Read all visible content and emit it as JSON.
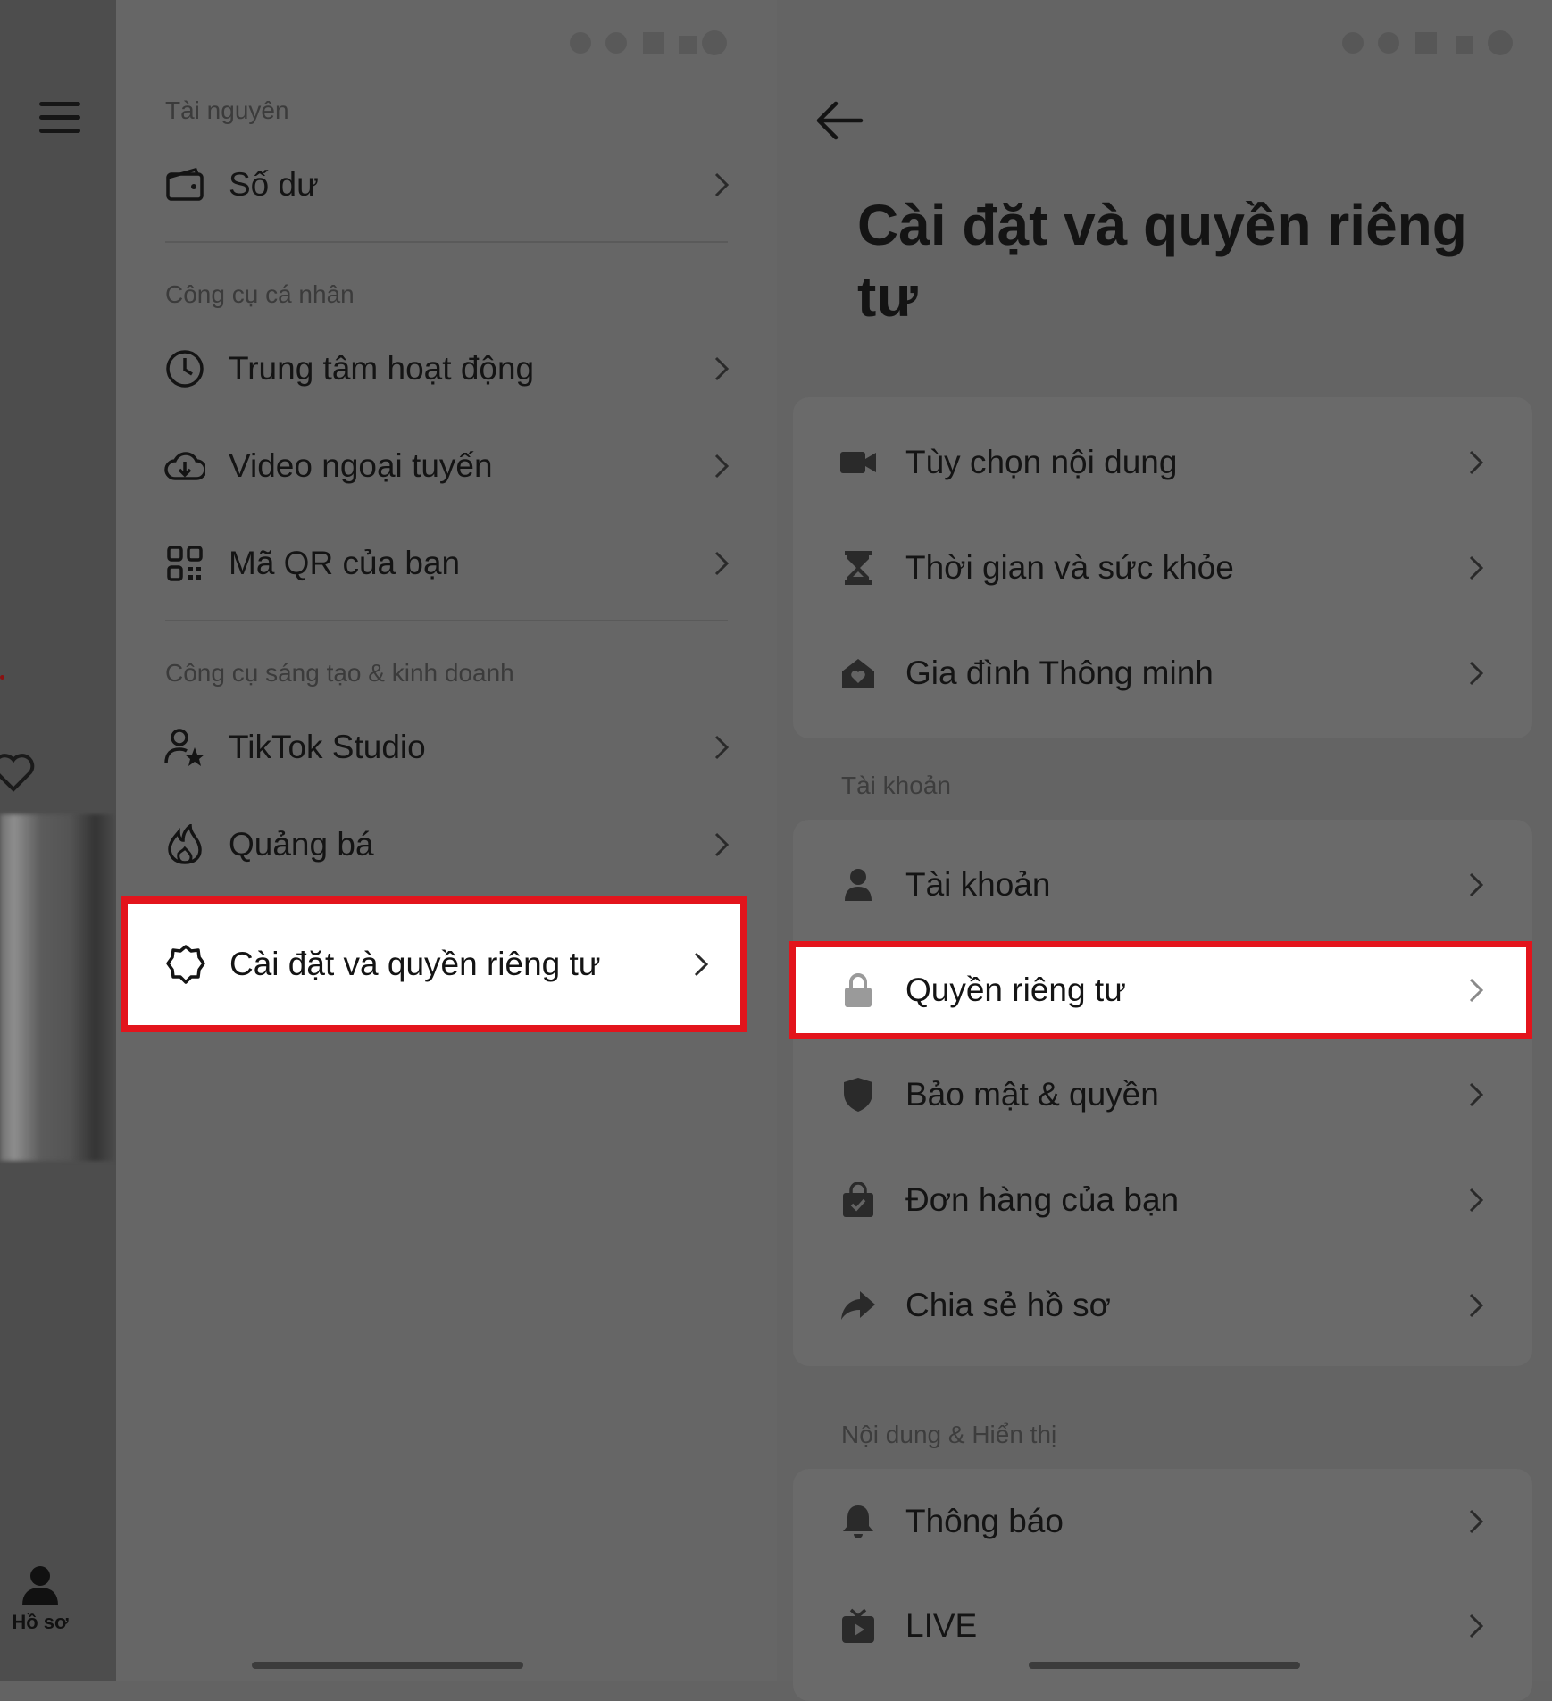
{
  "profile": {
    "tab_label": "Hồ sơ"
  },
  "drawer": {
    "sections": [
      {
        "label": "Tài nguyên"
      },
      {
        "label": "Công cụ cá nhân"
      },
      {
        "label": "Công cụ sáng tạo & kinh doanh"
      }
    ],
    "items": [
      {
        "label": "Số dư",
        "icon": "wallet-icon"
      },
      {
        "label": "Trung tâm hoạt động",
        "icon": "clock-icon"
      },
      {
        "label": "Video ngoại tuyến",
        "icon": "cloud-download-icon"
      },
      {
        "label": "Mã QR của bạn",
        "icon": "qr-code-icon"
      },
      {
        "label": "TikTok Studio",
        "icon": "user-star-icon"
      },
      {
        "label": "Quảng bá",
        "icon": "flame-icon"
      },
      {
        "label": "Cài đặt và quyền riêng tư",
        "icon": "settings-gear-icon",
        "highlighted": true
      }
    ]
  },
  "settings": {
    "title": "Cài đặt và quyền riêng tư",
    "group1": [
      {
        "label": "Tùy chọn nội dung",
        "icon": "video-camera-icon"
      },
      {
        "label": "Thời gian và sức khỏe",
        "icon": "hourglass-icon"
      },
      {
        "label": "Gia đình Thông minh",
        "icon": "home-heart-icon"
      }
    ],
    "section_account": "Tài khoản",
    "group2": [
      {
        "label": "Tài khoản",
        "icon": "person-icon"
      },
      {
        "label": "Quyền riêng tư",
        "icon": "lock-icon",
        "highlighted": true
      },
      {
        "label": "Bảo mật & quyền",
        "icon": "shield-icon"
      },
      {
        "label": "Đơn hàng của bạn",
        "icon": "shopping-bag-icon"
      },
      {
        "label": "Chia sẻ hồ sơ",
        "icon": "share-arrow-icon"
      }
    ],
    "section_content": "Nội dung & Hiển thị",
    "group3": [
      {
        "label": "Thông báo",
        "icon": "bell-icon"
      },
      {
        "label": "LIVE",
        "icon": "tv-play-icon"
      }
    ]
  },
  "colors": {
    "highlight_border": "#e3141c",
    "overlay_bg": "#666666",
    "text": "#141414"
  }
}
